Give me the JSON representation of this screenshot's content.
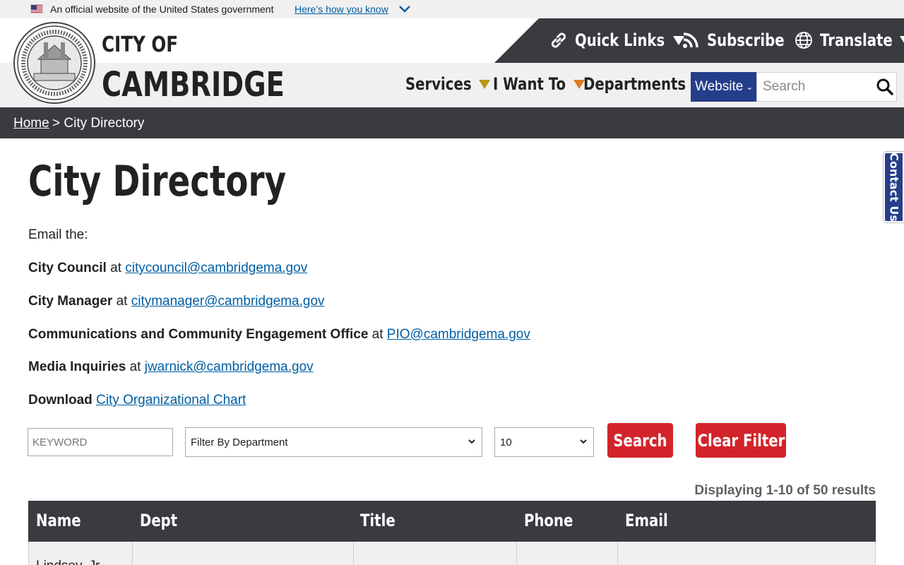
{
  "gov_banner": {
    "text": "An official website of the United States government",
    "link": "Here’s how you know"
  },
  "brand": {
    "line1": "CITY OF",
    "line2": "CAMBRIDGE"
  },
  "quick_links": [
    {
      "label": "Quick Links",
      "icon": "link-icon",
      "dropdown": true
    },
    {
      "label": "Subscribe",
      "icon": "rss-icon",
      "dropdown": false
    },
    {
      "label": "Translate",
      "icon": "globe-icon",
      "dropdown": true
    }
  ],
  "main_nav": [
    {
      "label": "Services",
      "color": "#b8960e"
    },
    {
      "label": "I Want To",
      "color": "#e07b1f"
    },
    {
      "label": "Departments",
      "color": "#2a9fd8"
    }
  ],
  "site_search": {
    "scope": "Website",
    "placeholder": "Search"
  },
  "breadcrumb": {
    "home": "Home",
    "separator": " > ",
    "current": "City Directory"
  },
  "contact_tab": "Contact Us",
  "page_title": "City Directory",
  "intro": {
    "email_the": "Email the:",
    "contacts": [
      {
        "label": "City Council",
        "at": " at ",
        "email": "citycouncil@cambridgema.gov"
      },
      {
        "label": "City Manager",
        "at": " at ",
        "email": "citymanager@cambridgema.gov"
      },
      {
        "label": "Communications and Community Engagement Office",
        "at": " at ",
        "email": "PIO@cambridgema.gov"
      },
      {
        "label": "Media Inquiries",
        "at": " at ",
        "email": "jwarnick@cambridgema.gov"
      }
    ],
    "download_label": "Download",
    "download_link": "City Organizational Chart"
  },
  "filters": {
    "keyword_placeholder": "KEYWORD",
    "department_selected": "Filter By Department",
    "page_size_selected": "10",
    "search_label": "Search",
    "clear_label": "Clear Filter"
  },
  "results_count": "Displaying 1-10 of 50 results",
  "table": {
    "columns": [
      "Name",
      "Dept",
      "Title",
      "Phone",
      "Email"
    ],
    "first_row_name": "Lindsey, Jr."
  },
  "colors": {
    "dark_bar": "#3a3b40",
    "link": "#005ea2",
    "accent_red": "#d3232a",
    "navy": "#253e8a"
  }
}
